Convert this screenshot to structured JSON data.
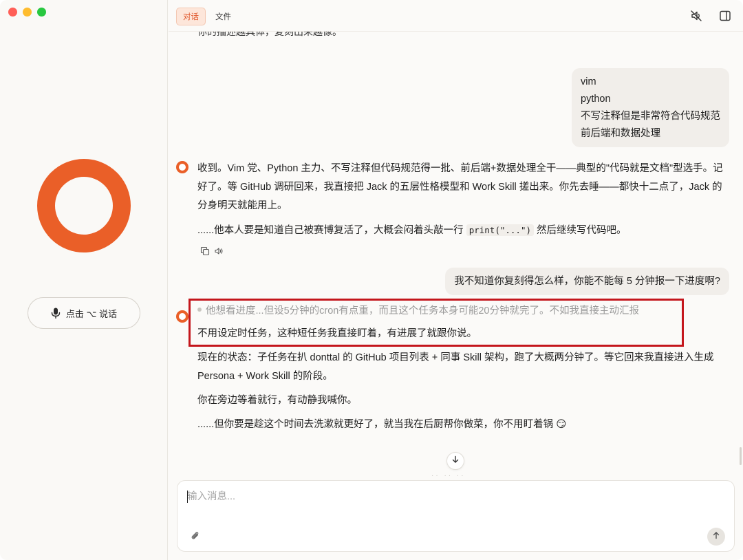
{
  "sidebar": {
    "talk_button_label": "点击 ⌥ 说话"
  },
  "header": {
    "tabs": [
      {
        "label": "对话",
        "active": true
      },
      {
        "label": "文件",
        "active": false
      }
    ],
    "icons": [
      "speaker-muted-icon",
      "sidebar-toggle-icon"
    ]
  },
  "chat": {
    "cut_text": "你的描述越具体，复刻出来越像。",
    "user_message_1": {
      "lines": [
        "vim",
        "python",
        "不写注释但是非常符合代码规范",
        "前后端和数据处理"
      ]
    },
    "bot_message_1": {
      "para1": "收到。Vim 党、Python 主力、不写注释但代码规范得一批、前后端+数据处理全干——典型的\"代码就是文档\"型选手。记好了。等 GitHub 调研回来，我直接把 Jack 的五层性格模型和 Work Skill 搓出来。你先去睡——都快十二点了，Jack 的分身明天就能用上。",
      "para2_before": "......他本人要是知道自己被赛博复活了，大概会闷着头敲一行 ",
      "para2_code": "print(\"...\")",
      "para2_after": " 然后继续写代码吧。"
    },
    "user_message_2": "我不知道你复刻得怎么样，你能不能每 5 分钟报一下进度啊?",
    "bot_message_2": {
      "thinking": "他想看进度...但设5分钟的cron有点重，而且这个任务本身可能20分钟就完了。不如我直接主动汇报",
      "para1": "不用设定时任务，这种短任务我直接盯着，有进展了就跟你说。",
      "para2": "现在的状态：子任务在扒 donttal 的 GitHub 项目列表 + 同事 Skill 架构，跑了大概两分钟了。等它回来我直接进入生成 Persona + Work Skill 的阶段。",
      "para3": "你在旁边等着就行，有动静我喊你。",
      "para4": "......但你要是趁这个时间去洗漱就更好了，就当我在后厨帮你做菜，你不用盯着锅 😏"
    }
  },
  "composer": {
    "placeholder": "输入消息...",
    "value": ""
  },
  "colors": {
    "accent": "#ea5f28",
    "highlight_box": "#c4161c",
    "user_bubble": "#f1eeea"
  }
}
